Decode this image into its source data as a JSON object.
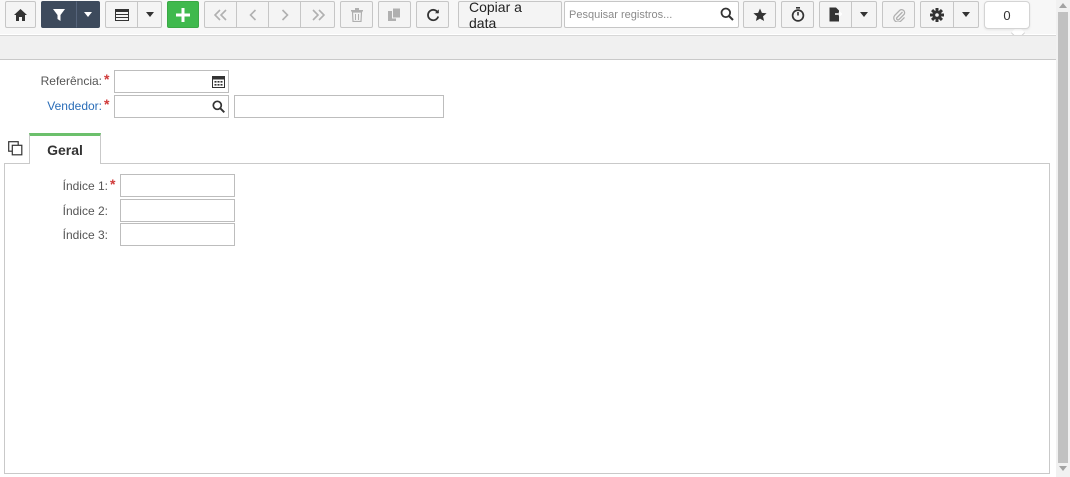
{
  "toolbar": {
    "copy_to_date_label": "Copiar a data",
    "search_placeholder": "Pesquisar registros...",
    "record_count": "0"
  },
  "header": {
    "reference_label": "Referência:",
    "vendor_label": "Vendedor:",
    "required_mark": "*"
  },
  "tabs": [
    {
      "label": "Geral"
    }
  ],
  "general": {
    "index1_label": "Índice 1:",
    "index2_label": "Índice 2:",
    "index3_label": "Índice 3:"
  },
  "colors": {
    "accent_dark": "#3d4a5c",
    "add_green": "#3fb94d",
    "tab_green": "#6cc06c",
    "link_blue": "#2a6db8",
    "required_red": "#d03a3a"
  }
}
